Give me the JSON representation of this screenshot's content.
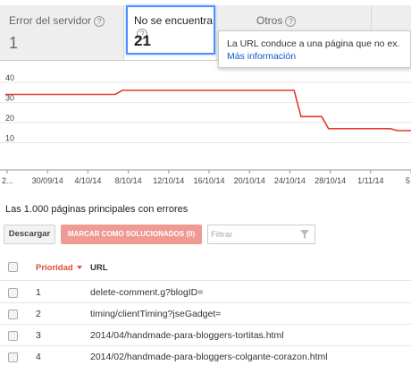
{
  "tabs": {
    "server_error": {
      "label": "Error del servidor",
      "count": "1"
    },
    "not_found": {
      "label": "No se encuentra",
      "count": "21"
    },
    "others": {
      "label": "Otros"
    }
  },
  "tooltip": {
    "text": "La URL conduce a una página que no ex.",
    "link": "Más información"
  },
  "chart_data": {
    "type": "line",
    "x_tick_labels": [
      "2...",
      "30/09/14",
      "4/10/14",
      "8/10/14",
      "12/10/14",
      "16/10/14",
      "20/10/14",
      "24/10/14",
      "28/10/14",
      "1/11/14",
      "5"
    ],
    "y_tick_labels": [
      "40",
      "30",
      "20",
      "10"
    ],
    "ylim": [
      0,
      40
    ],
    "series_color": "#e03a2f",
    "series": [
      {
        "values": [
          34,
          34,
          34,
          34,
          34,
          34,
          34,
          34,
          34,
          34,
          34,
          34,
          34,
          34,
          34,
          34,
          34,
          36,
          36,
          36,
          36,
          36,
          36,
          36,
          36,
          36,
          36,
          36,
          36,
          36,
          36,
          36,
          36,
          36,
          36,
          36,
          36,
          36,
          36,
          36,
          36,
          36,
          36,
          23,
          23,
          23,
          23,
          17,
          17,
          17,
          17,
          17,
          17,
          17,
          17,
          17,
          17,
          16,
          16,
          16
        ]
      }
    ]
  },
  "summary": "Las 1.000 páginas principales con errores",
  "toolbar": {
    "download": "Descargar",
    "mark_fixed": "MARCAR COMO SOLUCIONADOS (0)",
    "filter_placeholder": "Filtrar"
  },
  "table": {
    "headers": {
      "priority": "Prioridad",
      "url": "URL"
    },
    "rows": [
      {
        "priority": "1",
        "url": "delete-comment.g?blogID="
      },
      {
        "priority": "2",
        "url": "timing/clientTiming?jseGadget="
      },
      {
        "priority": "3",
        "url": "2014/04/handmade-para-bloggers-tortitas.html"
      },
      {
        "priority": "4",
        "url": "2014/02/handmade-para-bloggers-colgante-corazon.html"
      }
    ]
  }
}
